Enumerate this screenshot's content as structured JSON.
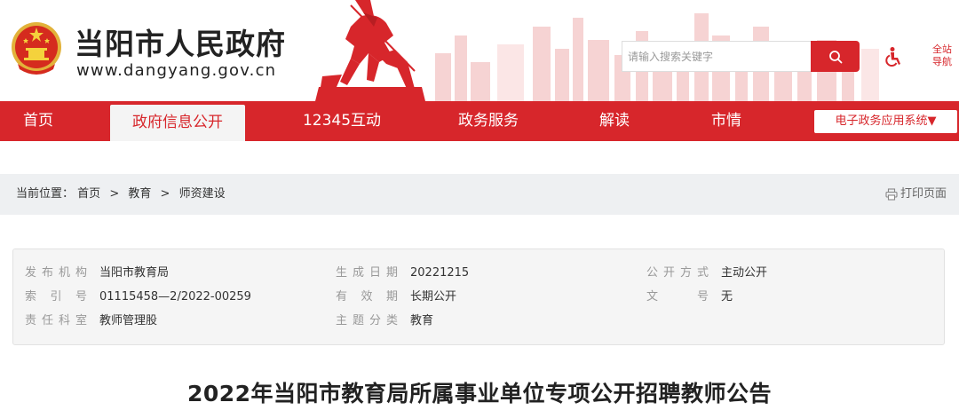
{
  "header": {
    "site_name": "当阳市人民政府",
    "site_url": "www.dangyang.gov.cn",
    "search_placeholder": "请输入搜索关键字",
    "site_nav_label": "全站导航"
  },
  "nav": {
    "items": [
      {
        "label": "首页",
        "active": false
      },
      {
        "label": "政府信息公开",
        "active": true
      },
      {
        "label": "12345互动",
        "active": false
      },
      {
        "label": "政务服务",
        "active": false
      },
      {
        "label": "解读",
        "active": false
      },
      {
        "label": "市情",
        "active": false
      }
    ],
    "egov_select": "电子政务应用系统▼"
  },
  "breadcrumb": {
    "prefix": "当前位置：",
    "items": [
      "首页",
      "教育",
      "师资建设"
    ],
    "separator": ">",
    "print_label": "打印页面"
  },
  "info": {
    "rows": [
      [
        {
          "label": "发布机构",
          "value": "当阳市教育局"
        },
        {
          "label": "生成日期",
          "value": "20221215"
        },
        {
          "label": "公开方式",
          "value": "主动公开"
        }
      ],
      [
        {
          "label": "索引号",
          "value": "01115458—2/2022-00259"
        },
        {
          "label": "有效期",
          "value": "长期公开"
        },
        {
          "label": "文号",
          "value": "无"
        }
      ],
      [
        {
          "label": "责任科室",
          "value": "教师管理股"
        },
        {
          "label": "主题分类",
          "value": "教育"
        }
      ]
    ]
  },
  "article": {
    "title": "2022年当阳市教育局所属事业单位专项公开招聘教师公告"
  },
  "colors": {
    "brand_red": "#d7262b",
    "crumb_bg": "#eef0f2",
    "info_bg": "#f5f5f5"
  }
}
